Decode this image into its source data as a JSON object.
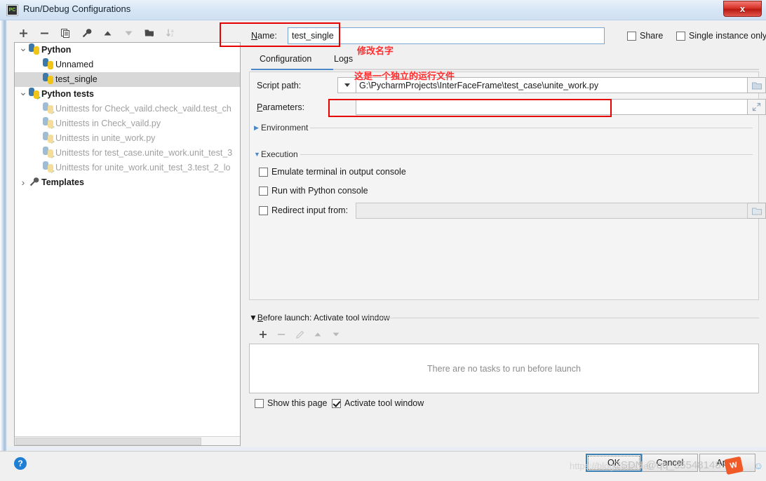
{
  "window": {
    "title": "Run/Debug Configurations",
    "icon": "pycharm-icon",
    "close_label": "x"
  },
  "toolbar": {
    "buttons": [
      {
        "name": "add-configuration-button",
        "glyph": "+",
        "enabled": true
      },
      {
        "name": "remove-configuration-button",
        "glyph": "−",
        "enabled": true
      },
      {
        "name": "copy-configuration-button",
        "glyph": "copy-icon",
        "enabled": true
      },
      {
        "name": "edit-templates-button",
        "glyph": "wrench-icon",
        "enabled": true
      },
      {
        "name": "move-up-button",
        "glyph": "arrow-up-icon",
        "enabled": true
      },
      {
        "name": "move-down-button",
        "glyph": "arrow-down-icon",
        "enabled": false
      },
      {
        "name": "move-into-folder-button",
        "glyph": "folder-add-icon",
        "enabled": true
      },
      {
        "name": "sort-configurations-button",
        "glyph": "sort-az-icon",
        "enabled": false
      }
    ]
  },
  "tree": {
    "items": [
      {
        "label": "Python",
        "level": 0,
        "expanded": true,
        "bold": true,
        "icon": "python-icon",
        "gray": false,
        "selected": false
      },
      {
        "label": "Unnamed",
        "level": 1,
        "expanded": null,
        "bold": false,
        "icon": "python-icon",
        "gray": false,
        "selected": false
      },
      {
        "label": "test_single",
        "level": 1,
        "expanded": null,
        "bold": false,
        "icon": "python-icon",
        "gray": false,
        "selected": true
      },
      {
        "label": "Python tests",
        "level": 0,
        "expanded": true,
        "bold": true,
        "icon": "python-test-icon",
        "gray": false,
        "selected": false
      },
      {
        "label": "Unittests for Check_vaild.check_vaild.test_ch",
        "level": 1,
        "expanded": null,
        "bold": false,
        "icon": "python-test-icon",
        "gray": true,
        "selected": false
      },
      {
        "label": "Unittests in Check_vaild.py",
        "level": 1,
        "expanded": null,
        "bold": false,
        "icon": "python-test-icon",
        "gray": true,
        "selected": false
      },
      {
        "label": "Unittests in unite_work.py",
        "level": 1,
        "expanded": null,
        "bold": false,
        "icon": "python-test-icon",
        "gray": true,
        "selected": false
      },
      {
        "label": "Unittests for test_case.unite_work.unit_test_3",
        "level": 1,
        "expanded": null,
        "bold": false,
        "icon": "python-test-icon",
        "gray": true,
        "selected": false
      },
      {
        "label": "Unittests for unite_work.unit_test_3.test_2_lo",
        "level": 1,
        "expanded": null,
        "bold": false,
        "icon": "python-test-icon",
        "gray": true,
        "selected": false
      },
      {
        "label": "Templates",
        "level": 0,
        "expanded": false,
        "bold": true,
        "icon": "wrench-icon",
        "gray": false,
        "selected": false
      }
    ]
  },
  "name_row": {
    "label": "Name:",
    "value": "test_single",
    "share": {
      "label": "Share",
      "checked": false
    },
    "single_instance": {
      "label": "Single instance only",
      "checked": false
    }
  },
  "tabs": {
    "items": [
      {
        "label": "Configuration",
        "active": true
      },
      {
        "label": "Logs",
        "active": false
      }
    ]
  },
  "configuration": {
    "script_path": {
      "label": "Script path:",
      "value": "G:\\PycharmProjects\\InterFaceFrame\\test_case\\unite_work.py"
    },
    "parameters": {
      "label": "Parameters:",
      "value": ""
    },
    "environment_section": {
      "label": "Environment",
      "expanded": false
    },
    "execution_section": {
      "label": "Execution",
      "expanded": true
    },
    "execution_options": [
      {
        "label": "Emulate terminal in output console",
        "checked": false,
        "name": "emulate-terminal-checkbox"
      },
      {
        "label": "Run with Python console",
        "checked": false,
        "name": "run-with-python-console-checkbox"
      },
      {
        "label": "Redirect input from:",
        "checked": false,
        "name": "redirect-input-checkbox"
      }
    ],
    "redirect_input_value": ""
  },
  "before_launch": {
    "header": "Before launch: Activate tool window",
    "empty_message": "There are no tasks to run before launch",
    "toolbar": [
      {
        "name": "add-task-button",
        "glyph": "+",
        "enabled": true
      },
      {
        "name": "remove-task-button",
        "glyph": "−",
        "enabled": false
      },
      {
        "name": "edit-task-button",
        "glyph": "pencil-icon",
        "enabled": false
      },
      {
        "name": "task-move-up-button",
        "glyph": "arrow-up-icon",
        "enabled": false
      },
      {
        "name": "task-move-down-button",
        "glyph": "arrow-down-icon",
        "enabled": false
      }
    ],
    "show_this_page": {
      "label": "Show this page",
      "checked": false
    },
    "activate_tool_window": {
      "label": "Activate tool window",
      "checked": true
    }
  },
  "footer": {
    "help": "?",
    "ok": "OK",
    "cancel": "Cancel",
    "apply": "Apply"
  },
  "annotations": {
    "name_note": "修改名字",
    "file_note": "这是一个独立的运行文件",
    "box_color": "#e60000"
  },
  "watermark": {
    "url": "https://blog.csdn.net",
    "credit": "CSDN @qq_35548148",
    "logo": "W",
    "smile": "☺"
  }
}
